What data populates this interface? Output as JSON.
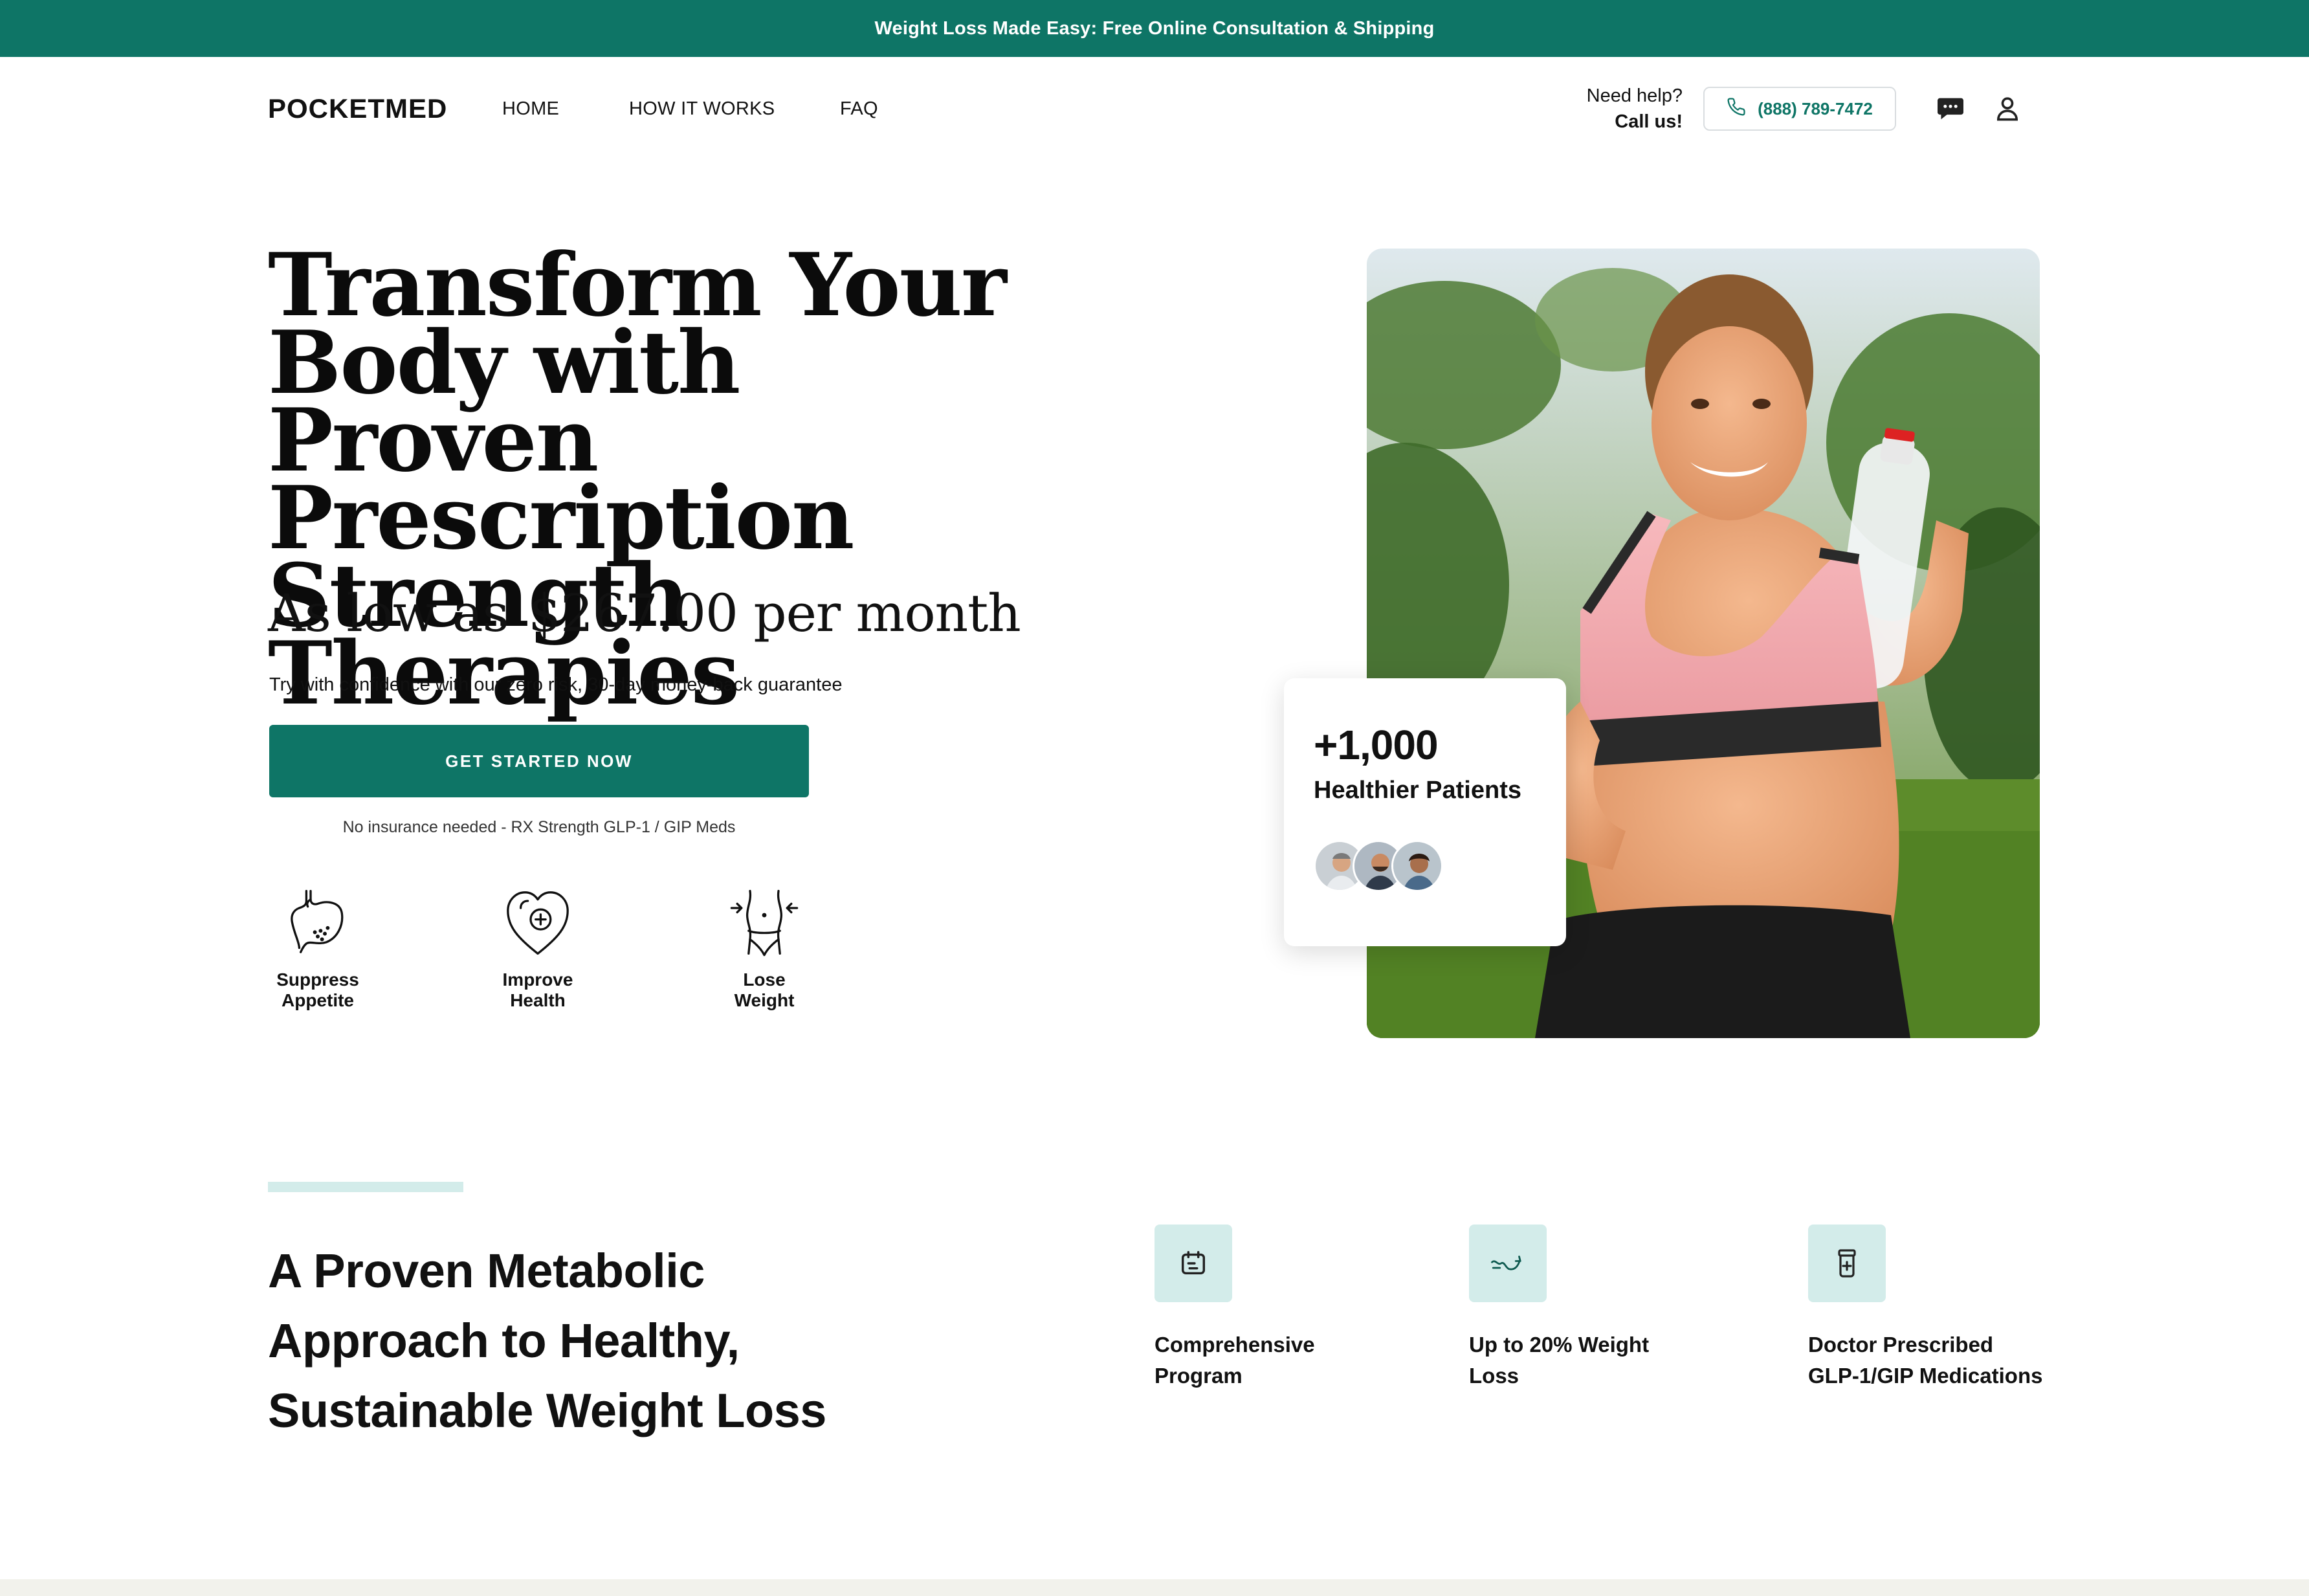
{
  "promo": {
    "text": "Weight Loss Made Easy: Free Online Consultation & Shipping"
  },
  "nav": {
    "logo": "POCKETMED",
    "links": [
      "HOME",
      "HOW IT WORKS",
      "FAQ"
    ],
    "help_line1": "Need help?",
    "help_line2": "Call us!",
    "phone": "(888) 789-7472",
    "icons": [
      "phone-icon",
      "chat-icon",
      "user-icon"
    ]
  },
  "hero": {
    "title_lines": [
      "Transform Your",
      "Body with Proven",
      "Prescription",
      "Strength Therapies"
    ],
    "price_prefix": "As low as",
    "price_highlight": "$267.00 per month",
    "guarantee": "Try with confidence with our zero risk, 30-day money-back guarantee",
    "cta": "GET STARTED NOW",
    "cta_note": "No insurance needed - RX Strength GLP-1 / GIP Meds",
    "benefits": [
      {
        "icon": "stomach-icon",
        "label_1": "Suppress",
        "label_2": "Appetite"
      },
      {
        "icon": "heart-plus-icon",
        "label_1": "Improve",
        "label_2": "Health"
      },
      {
        "icon": "waist-icon",
        "label_1": "Lose",
        "label_2": "Weight"
      }
    ],
    "stats": {
      "number": "+1,000",
      "label": "Healthier Patients"
    }
  },
  "section": {
    "title_lines": [
      "A Proven Metabolic",
      "Approach to Healthy,",
      "Sustainable Weight Loss"
    ],
    "features": [
      {
        "icon": "calendar-icon",
        "line_1": "Comprehensive",
        "line_2": "Program"
      },
      {
        "icon": "scale-curve-icon",
        "line_1": "Up to 20% Weight",
        "line_2": "Loss"
      },
      {
        "icon": "pill-bottle-icon",
        "line_1": "Doctor Prescribed",
        "line_2": "GLP-1/GIP Medications"
      }
    ]
  },
  "colors": {
    "brand": "#0e7566",
    "accent_light": "#d3ecea",
    "text": "#111111"
  }
}
